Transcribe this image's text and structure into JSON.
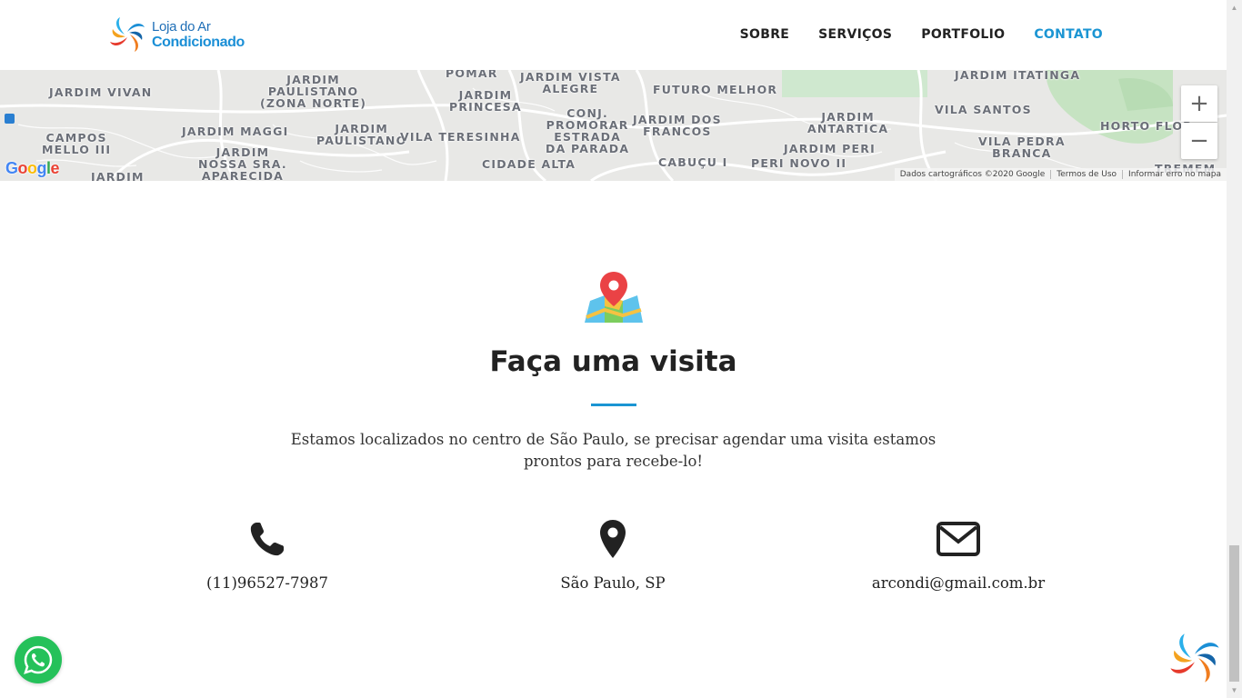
{
  "brand": {
    "line1": "Loja do Ar",
    "line2": "Condicionado"
  },
  "nav": {
    "items": [
      {
        "label": "SOBRE"
      },
      {
        "label": "SERVIÇOS"
      },
      {
        "label": "PORTFOLIO"
      },
      {
        "label": "CONTATO",
        "active": true
      }
    ]
  },
  "map": {
    "labels": [
      "JARDIM VIVAN",
      "JARDIM\nPAULISTANO\n(ZONA NORTE)",
      "POMAR",
      "JARDIM\nPRINCESA",
      "JARDIM VISTA\nALEGRE",
      "FUTURO MELHOR",
      "JARDIM ITATINGA",
      "VILA SANTOS",
      "HORTO FLOR",
      "CAMPOS\nMELLO III",
      "JARDIM MAGGI",
      "JARDIM\nPAULISTANO",
      "VILA TERESINHA",
      "CONJ.\nPROMORAR\nESTRADA\nDA PARADA",
      "JARDIM DOS\nFRANCOS",
      "JARDIM\nANTARTICA",
      "VILA PEDRA\nBRANCA",
      "JARDIM\nNOSSA SRA.\nAPARECIDA",
      "CIDADE ALTA",
      "CABUÇU I",
      "PERI NOVO II",
      "JARDIM PERI",
      "JARDIM",
      "TREMEM"
    ],
    "zoom_in": "+",
    "zoom_out": "−",
    "google": "Google",
    "footer": {
      "data": "Dados cartográficos ©2020 Google",
      "terms": "Termos de Uso",
      "report": "Informar erro no mapa"
    }
  },
  "visit": {
    "title": "Faça uma visita",
    "description": "Estamos localizados no centro de São Paulo, se precisar agendar uma visita estamos prontos para recebe-lo!"
  },
  "contacts": {
    "phone": "(11)96527-7987",
    "location": "São Paulo, SP",
    "email": "arcondi@gmail.com.br"
  },
  "colors": {
    "accent": "#1b95d3",
    "whatsapp": "#25c15a"
  },
  "icons": {
    "phone": "phone-icon",
    "location": "map-pin-icon",
    "email": "envelope-icon",
    "visit": "map-icon",
    "whatsapp": "whatsapp-icon"
  }
}
